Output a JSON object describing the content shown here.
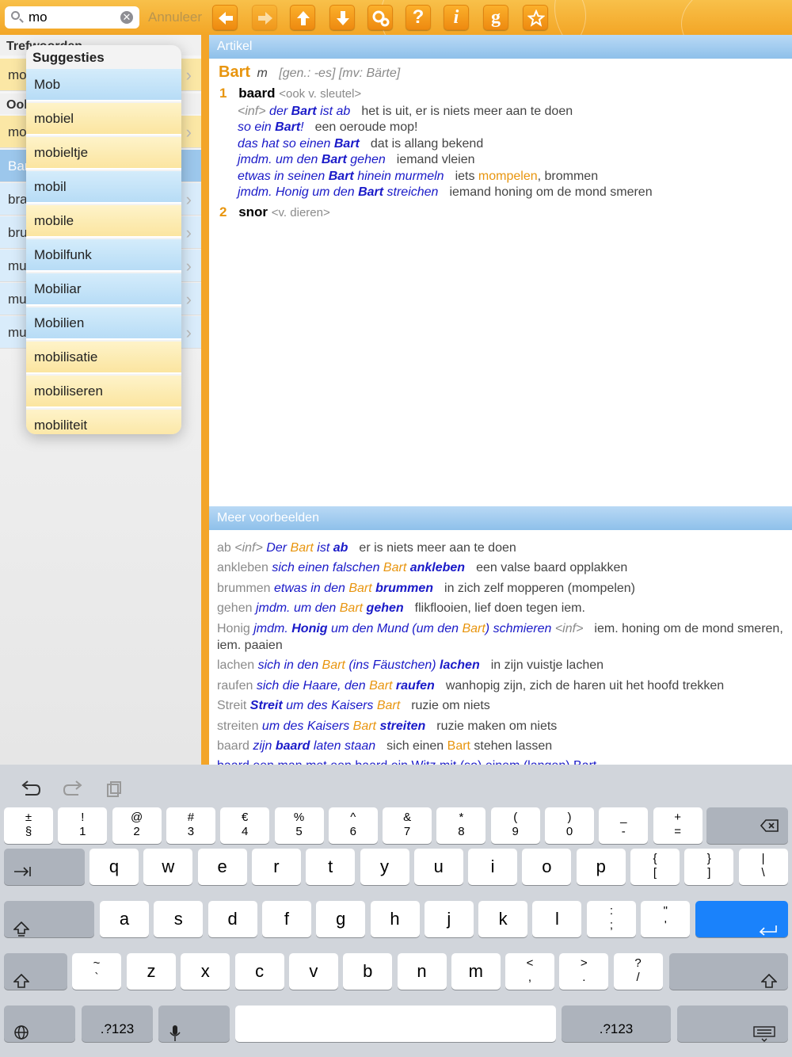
{
  "search": {
    "value": "mo",
    "clear_glyph": "✕",
    "cancel": "Annuleer"
  },
  "toolbar": {
    "icons": [
      "arrow-left-icon",
      "arrow-right-icon",
      "arrow-up-icon",
      "arrow-down-icon",
      "gears-icon",
      "help-icon",
      "info-icon",
      "google-icon",
      "star-icon"
    ],
    "help_label": "?",
    "info_label": "i",
    "google_label": "g"
  },
  "left": {
    "section1": "Trefwoorden",
    "row1": "mo",
    "section2": "Ook",
    "rows": [
      "mo",
      "Bar",
      "bra",
      "bru",
      "mu",
      "mu",
      "mu"
    ]
  },
  "suggestions": {
    "title": "Suggesties",
    "items": [
      "Mob",
      "mobiel",
      "mobieltje",
      "mobil",
      "mobile",
      "Mobilfunk",
      "Mobiliar",
      "Mobilien",
      "mobilisatie",
      "mobiliseren",
      "mobiliteit"
    ]
  },
  "article": {
    "header": "Artikel",
    "head_word": "Bart",
    "gender": "m",
    "grammar": "[gen.: -es] [mv: Bärte]",
    "sense1_num": "1",
    "sense1": "baard",
    "sense1_note": "<ook v. sleutel>",
    "lines": [
      {
        "a": "<inf>",
        "b": " der ",
        "c": "Bart",
        "d": " ist ab",
        "e": "het is uit, er is niets meer aan te doen"
      },
      {
        "b": "so ein ",
        "c": "Bart",
        "d": "!",
        "e": "een oeroude mop!"
      },
      {
        "b": "das hat so einen ",
        "c": "Bart",
        "d": "",
        "e": "dat is allang bekend"
      },
      {
        "b": "jmdm. um den ",
        "c": "Bart",
        "d": " gehen",
        "e": "iemand vleien"
      },
      {
        "b": "etwas in seinen ",
        "c": "Bart",
        "d": " hinein murmeln",
        "e": "iets ",
        "f": "mompelen",
        ",g": "",
        "g": ", brommen"
      },
      {
        "b": "jmdm. Honig um den ",
        "c": "Bart",
        "d": " streichen",
        "e": "iemand honing om de mond smeren"
      }
    ],
    "sense2_num": "2",
    "sense2": "snor",
    "sense2_note": "<v. dieren>"
  },
  "more": {
    "header": "Meer voorbeelden",
    "items": [
      [
        "ab ",
        "<inf> ",
        "Der ",
        "Bart",
        " ist ",
        "ab",
        "er is niets meer aan te doen"
      ],
      [
        "ankleben ",
        "sich einen falschen ",
        "Bart",
        " ",
        "ankleben",
        "een valse baard opplakken"
      ],
      [
        "brummen ",
        "etwas in den ",
        "Bart",
        " ",
        "brummen",
        "in zich zelf mopperen (mompelen)"
      ],
      [
        "gehen ",
        "jmdm. um den ",
        "Bart",
        " ",
        "gehen",
        "flikflooien, lief doen tegen iem."
      ],
      [
        "lachen ",
        "sich in den ",
        "Bart",
        " (ins Fäustchen) ",
        "lachen",
        "in zijn vuistje lachen"
      ],
      [
        "raufen ",
        "sich die Haare, den ",
        "Bart",
        " ",
        "raufen",
        "wanhopig zijn, zich de haren uit het hoofd trekken"
      ],
      [
        "streiten ",
        "um des Kaisers ",
        "Bart",
        " ",
        "streiten",
        "ruzie maken om niets"
      ]
    ],
    "honig": {
      "a": "Honig ",
      "b": "jmdm. ",
      "c": "Honig",
      " d": "",
      "d": " um den Mund (um den ",
      "e": "Bart",
      "f": ") schmieren ",
      "g": "<inf>",
      "h": "iem. honing om de mond smeren, iem. paaien"
    },
    "streit": {
      "a": "Streit ",
      "b": "Streit",
      " c": "",
      "c": " um des Kaisers ",
      "d": "Bart",
      "e": "ruzie om niets"
    },
    "baard": {
      "a": "baard ",
      "b": "zijn ",
      "c": "baard",
      "d": " laten staan",
      "e": "sich einen ",
      "f": "Bart",
      "g": " stehen lassen"
    },
    "cut": "baard een man met een baard  ein Witz mit (so) einem (langen) Bart"
  },
  "keyboard": {
    "num_row": [
      [
        "±",
        "§"
      ],
      [
        "!",
        "1"
      ],
      [
        "@",
        "2"
      ],
      [
        "#",
        "3"
      ],
      [
        "€",
        "4"
      ],
      [
        "%",
        "5"
      ],
      [
        "^",
        "6"
      ],
      [
        "&",
        "7"
      ],
      [
        "*",
        "8"
      ],
      [
        "(",
        "9"
      ],
      [
        ")",
        "0"
      ],
      [
        "_",
        "-"
      ],
      [
        "+",
        "="
      ]
    ],
    "row_q": [
      "q",
      "w",
      "e",
      "r",
      "t",
      "y",
      "u",
      "i",
      "o",
      "p"
    ],
    "row_q_extra": [
      [
        "{",
        "["
      ],
      [
        "}",
        "]"
      ],
      [
        "|",
        "\\"
      ]
    ],
    "row_a": [
      "a",
      "s",
      "d",
      "f",
      "g",
      "h",
      "j",
      "k",
      "l"
    ],
    "row_a_extra": [
      [
        ":",
        ";"
      ],
      [
        "\"",
        "'"
      ]
    ],
    "row_z_first": [
      "~",
      "`"
    ],
    "row_z": [
      "z",
      "x",
      "c",
      "v",
      "b",
      "n",
      "m"
    ],
    "row_z_extra": [
      [
        "<",
        ","
      ],
      [
        ">",
        "."
      ],
      [
        "?",
        "/"
      ]
    ],
    "num_switch": ".?123"
  }
}
